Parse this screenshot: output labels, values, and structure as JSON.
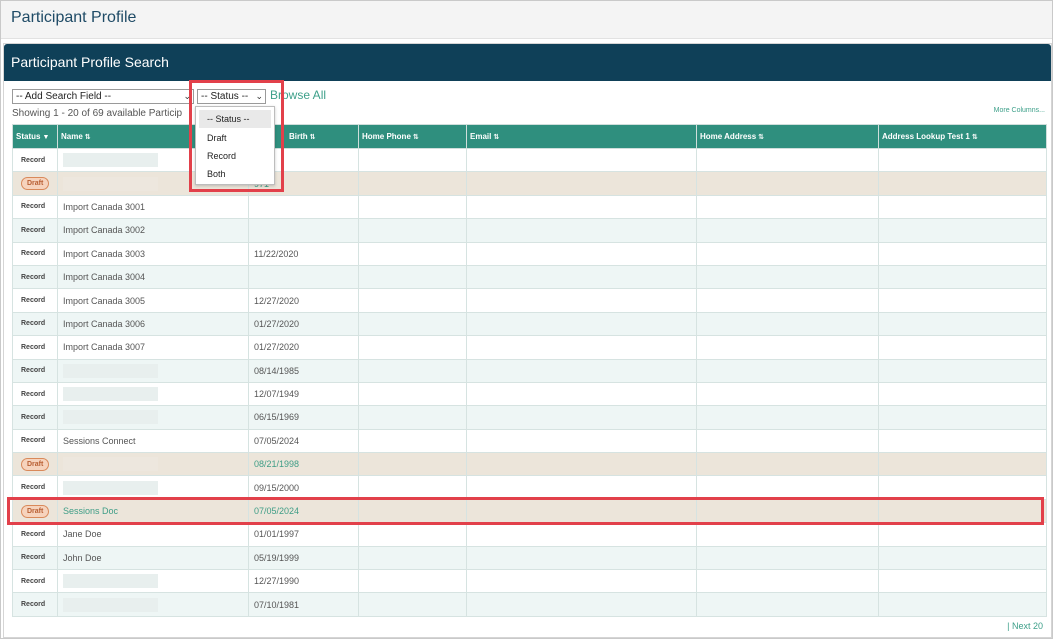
{
  "page": {
    "title": "Participant Profile"
  },
  "panel": {
    "title": "Participant Profile Search"
  },
  "toolbar": {
    "add_search_field": "-- Add Search Field --",
    "status_select": "-- Status --",
    "browse_all": "Browse All",
    "showing": "Showing 1 - 20 of 69 available Particip",
    "more_columns": "More Columns..."
  },
  "status_dropdown": {
    "options": [
      "-- Status --",
      "Draft",
      "Record",
      "Both"
    ],
    "selected": "-- Status --"
  },
  "table": {
    "headers": [
      "Status",
      "Name",
      "Birth",
      "Home Phone",
      "Email",
      "Home Address",
      "Address Lookup Test 1"
    ],
    "rows": [
      {
        "status": "Record",
        "name": "",
        "birth": "989"
      },
      {
        "status": "Draft",
        "name": "",
        "birth": "971"
      },
      {
        "status": "Record",
        "name": "Import Canada 3001",
        "birth": ""
      },
      {
        "status": "Record",
        "name": "Import Canada 3002",
        "birth": ""
      },
      {
        "status": "Record",
        "name": "Import Canada 3003",
        "birth": "11/22/2020"
      },
      {
        "status": "Record",
        "name": "Import Canada 3004",
        "birth": ""
      },
      {
        "status": "Record",
        "name": "Import Canada 3005",
        "birth": "12/27/2020"
      },
      {
        "status": "Record",
        "name": "Import Canada 3006",
        "birth": "01/27/2020"
      },
      {
        "status": "Record",
        "name": "Import Canada 3007",
        "birth": "01/27/2020"
      },
      {
        "status": "Record",
        "name": "",
        "birth": "08/14/1985"
      },
      {
        "status": "Record",
        "name": "",
        "birth": "12/07/1949"
      },
      {
        "status": "Record",
        "name": "",
        "birth": "06/15/1969"
      },
      {
        "status": "Record",
        "name": "Sessions Connect",
        "birth": "07/05/2024"
      },
      {
        "status": "Draft",
        "name": "",
        "birth": "08/21/1998"
      },
      {
        "status": "Record",
        "name": "",
        "birth": "09/15/2000"
      },
      {
        "status": "Draft",
        "name": "Sessions Doc",
        "birth": "07/05/2024"
      },
      {
        "status": "Record",
        "name": "Jane Doe",
        "birth": "01/01/1997"
      },
      {
        "status": "Record",
        "name": "John Doe",
        "birth": "05/19/1999"
      },
      {
        "status": "Record",
        "name": "",
        "birth": "12/27/1990"
      },
      {
        "status": "Record",
        "name": "",
        "birth": "07/10/1981"
      }
    ]
  },
  "pagination": {
    "next": "| Next 20"
  },
  "colors": {
    "header_bg": "#0f4058",
    "table_header": "#2f8f7e",
    "accent": "#3ea08a",
    "highlight": "#e2404a"
  }
}
